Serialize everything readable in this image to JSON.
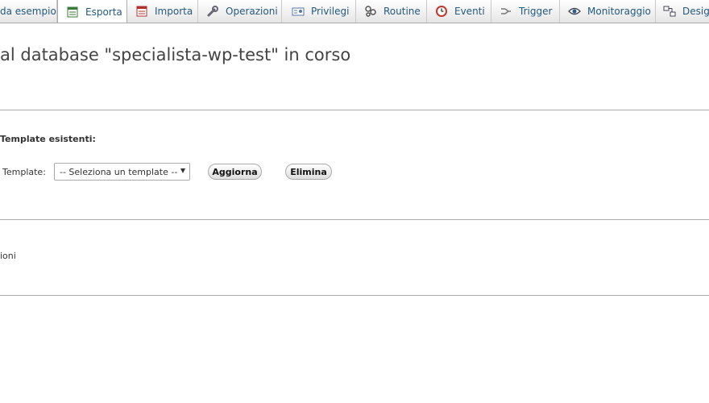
{
  "tabs": [
    {
      "label": "da esempio",
      "icon": "",
      "active": false
    },
    {
      "label": "Esporta",
      "icon": "export-icon",
      "active": true
    },
    {
      "label": "Importa",
      "icon": "import-icon",
      "active": false
    },
    {
      "label": "Operazioni",
      "icon": "wrench-icon",
      "active": false
    },
    {
      "label": "Privilegi",
      "icon": "privileges-icon",
      "active": false
    },
    {
      "label": "Routine",
      "icon": "routines-icon",
      "active": false
    },
    {
      "label": "Eventi",
      "icon": "clock-icon",
      "active": false
    },
    {
      "label": "Trigger",
      "icon": "trigger-icon",
      "active": false
    },
    {
      "label": "Monitoraggio",
      "icon": "eye-icon",
      "active": false
    },
    {
      "label": "Desig",
      "icon": "designer-icon",
      "active": false
    }
  ],
  "page": {
    "title": "al database \"specialista-wp-test\" in corso"
  },
  "templates": {
    "heading": "Template esistenti:",
    "field_label": "Template:",
    "select_value": "-- Seleziona un template --",
    "update_button": "Aggiorna",
    "delete_button": "Elimina"
  },
  "next_section": {
    "fragment": "ioni"
  },
  "colors": {
    "tab_text": "#235a81",
    "title_text": "#444444",
    "rule": "#aaaaaa"
  }
}
